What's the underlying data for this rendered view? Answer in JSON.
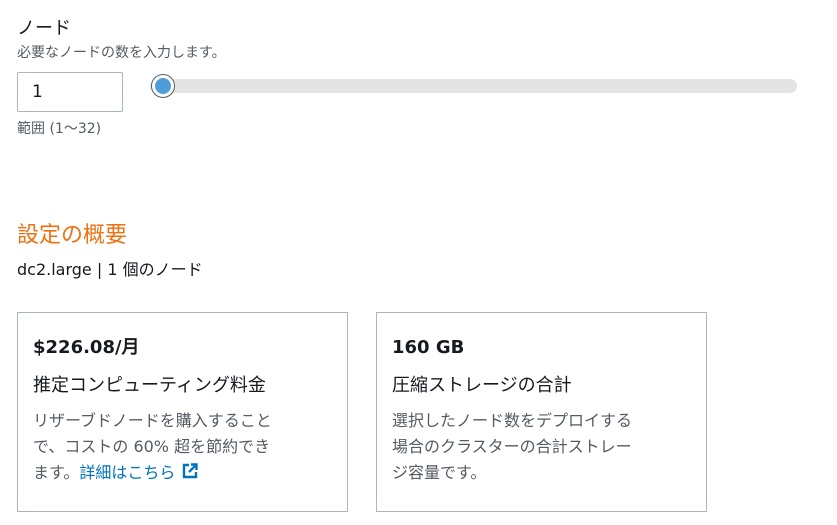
{
  "node": {
    "title": "ノード",
    "description": "必要なノードの数を入力します。",
    "value": "1",
    "slider_value": 1,
    "slider_min": 1,
    "slider_max": 32,
    "range_text": "範囲 (1〜32)"
  },
  "summary": {
    "title": "設定の概要",
    "subtitle": "dc2.large | 1 個のノード"
  },
  "cards": {
    "compute": {
      "value": "$226.08/月",
      "label": "推定コンピューティング料金",
      "desc_line1": "リザーブドノードを購入すること",
      "desc_line2": "で、コストの 60% 超を節約でき",
      "desc_line3": "ます。",
      "link_text": "詳細はこちら",
      "link_icon": "external-link-icon"
    },
    "storage": {
      "value": "160 GB",
      "label": "圧縮ストレージの合計",
      "desc_line1": "選択したノード数をデプロイする",
      "desc_line2": "場合のクラスターの合計ストレー",
      "desc_line3": "ジ容量です。"
    }
  },
  "colors": {
    "accent": "#ec7211",
    "link": "#0073bb",
    "slider_thumb": "#4f9dd8",
    "muted_text": "#545b64"
  }
}
